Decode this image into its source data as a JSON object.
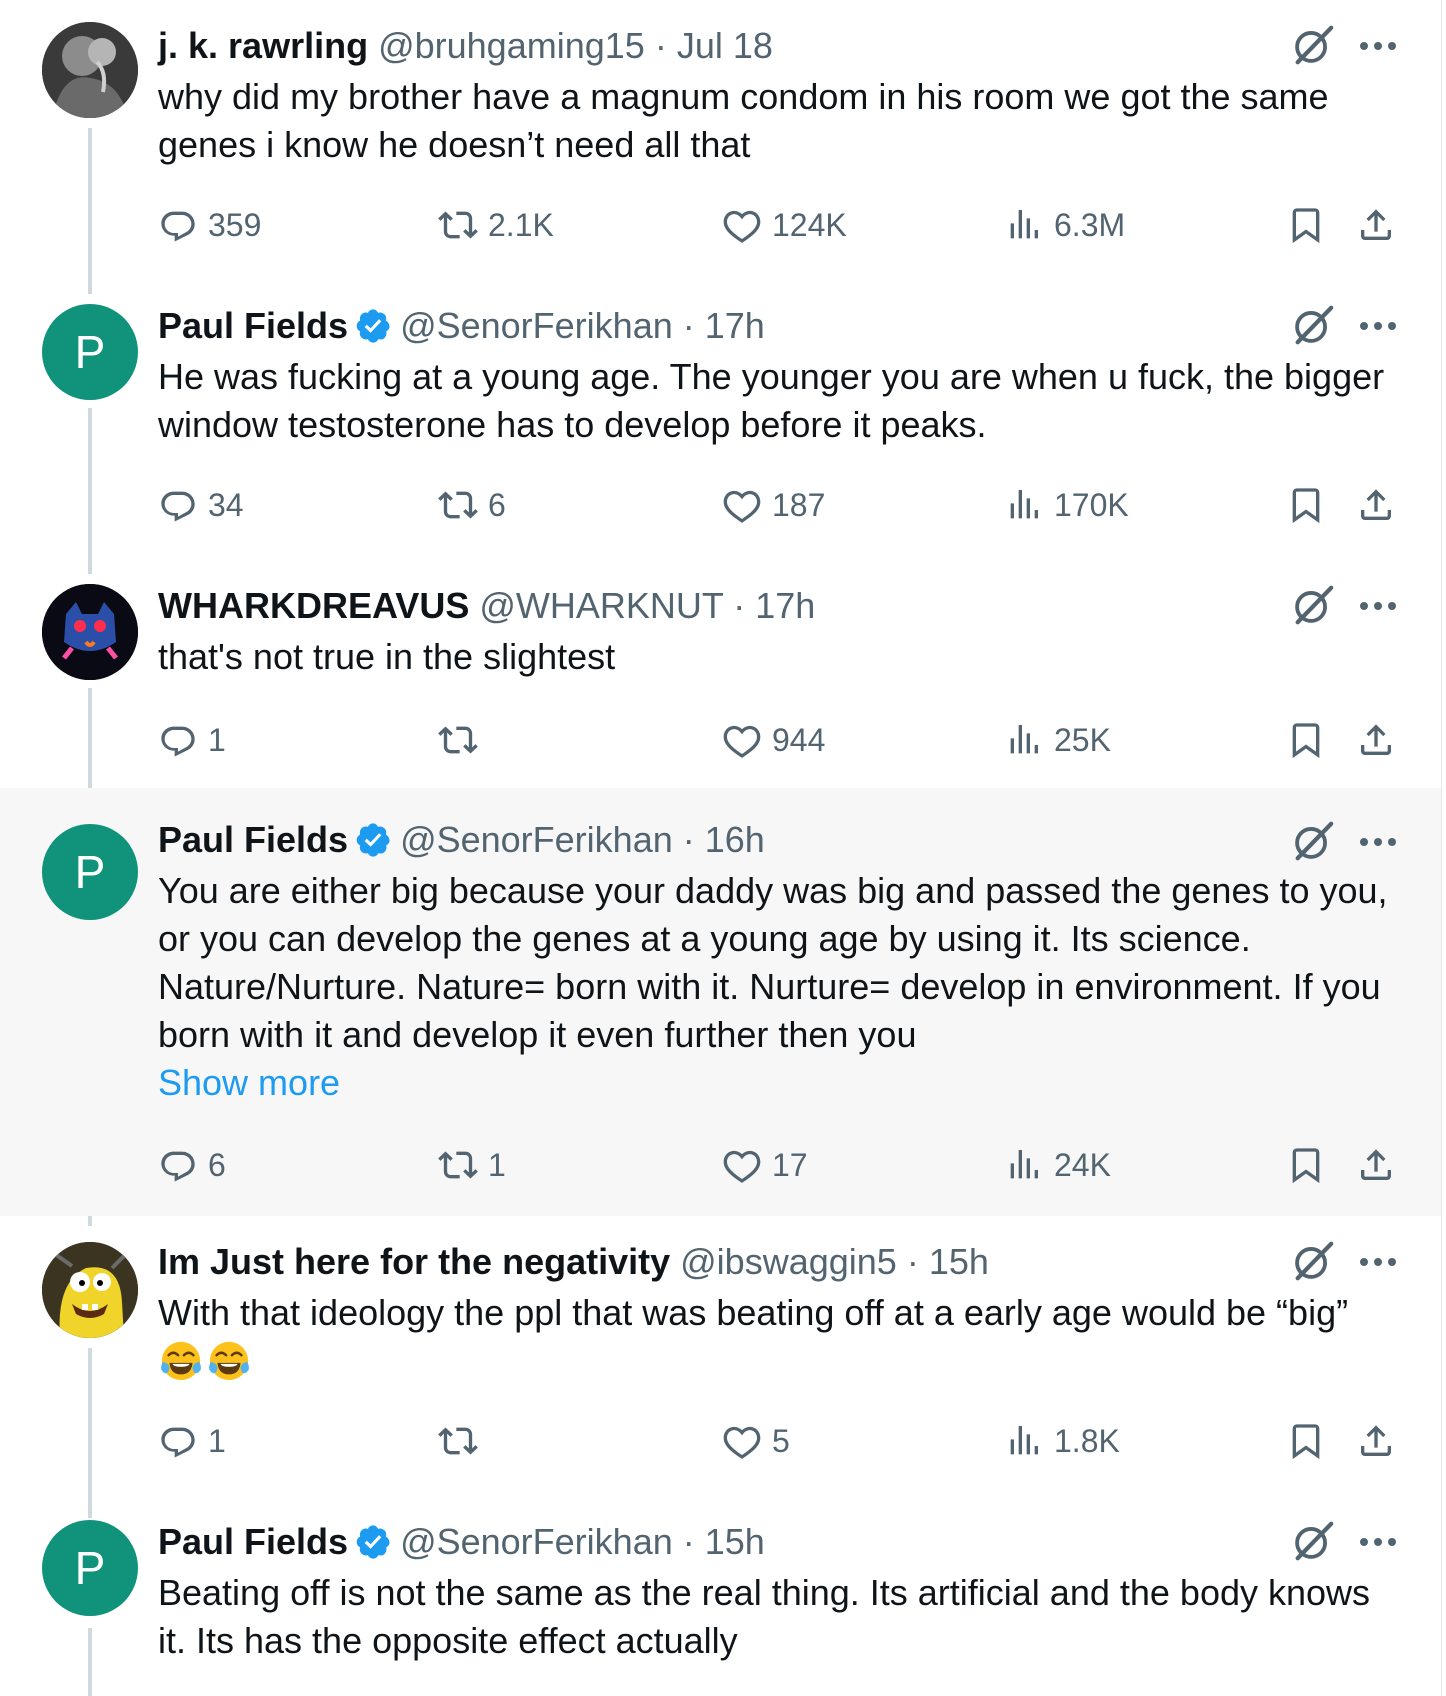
{
  "tweets": [
    {
      "name": "j. k. rawrling",
      "handle": "@bruhgaming15",
      "separator": "·",
      "time": "Jul 18",
      "text": "why did my brother have a magnum condom in his room we got the same genes i know he doesn’t need all that",
      "replies": "359",
      "retweets": "2.1K",
      "likes": "124K",
      "views": "6.3M"
    },
    {
      "name": "Paul Fields",
      "handle": "@SenorFerikhan",
      "separator": "·",
      "time": "17h",
      "avatar_letter": "P",
      "text": "He was fucking at a young age. The younger you are when u fuck, the bigger window testosterone has to develop before it peaks.",
      "replies": "34",
      "retweets": "6",
      "likes": "187",
      "views": "170K"
    },
    {
      "name": "WHARKDREAVUS",
      "handle": "@WHARKNUT",
      "separator": "·",
      "time": "17h",
      "text": "that's not true in the slightest",
      "replies": "1",
      "retweets": "",
      "likes": "944",
      "views": "25K"
    },
    {
      "name": "Paul Fields",
      "handle": "@SenorFerikhan",
      "separator": "·",
      "time": "16h",
      "avatar_letter": "P",
      "text": "You are either big because your daddy was big and passed the genes to you, or you can develop the genes at a young age by using it. Its science. Nature/Nurture. Nature= born with it. Nurture= develop in environment. If you born with it and develop it even further then you",
      "show_more": "Show more",
      "replies": "6",
      "retweets": "1",
      "likes": "17",
      "views": "24K"
    },
    {
      "name": "Im Just here for the negativity",
      "handle": "@ibswaggin5",
      "separator": "·",
      "time": "15h",
      "text": "With that ideology the ppl that was beating off at a early age would be “big”",
      "emojis": "face-with-tears-of-joy x2",
      "replies": "1",
      "retweets": "",
      "likes": "5",
      "views": "1.8K"
    },
    {
      "name": "Paul Fields",
      "handle": "@SenorFerikhan",
      "separator": "·",
      "time": "15h",
      "avatar_letter": "P",
      "text": "Beating off is not the same as the real thing. Its artificial and the body knows it. Its has the opposite effect actually"
    }
  ],
  "colors": {
    "text": "#0f1419",
    "secondary": "#536471",
    "link": "#1d9bf0",
    "verified": "#1d9bf0",
    "avatar_p": "#11927a",
    "highlight_bg": "#f7f7f7",
    "thread_line": "#cfd9de"
  },
  "icons": [
    "reply-icon",
    "retweet-icon",
    "like-icon",
    "views-icon",
    "bookmark-icon",
    "share-icon",
    "grok-icon",
    "more-icon",
    "verified-badge-icon"
  ]
}
